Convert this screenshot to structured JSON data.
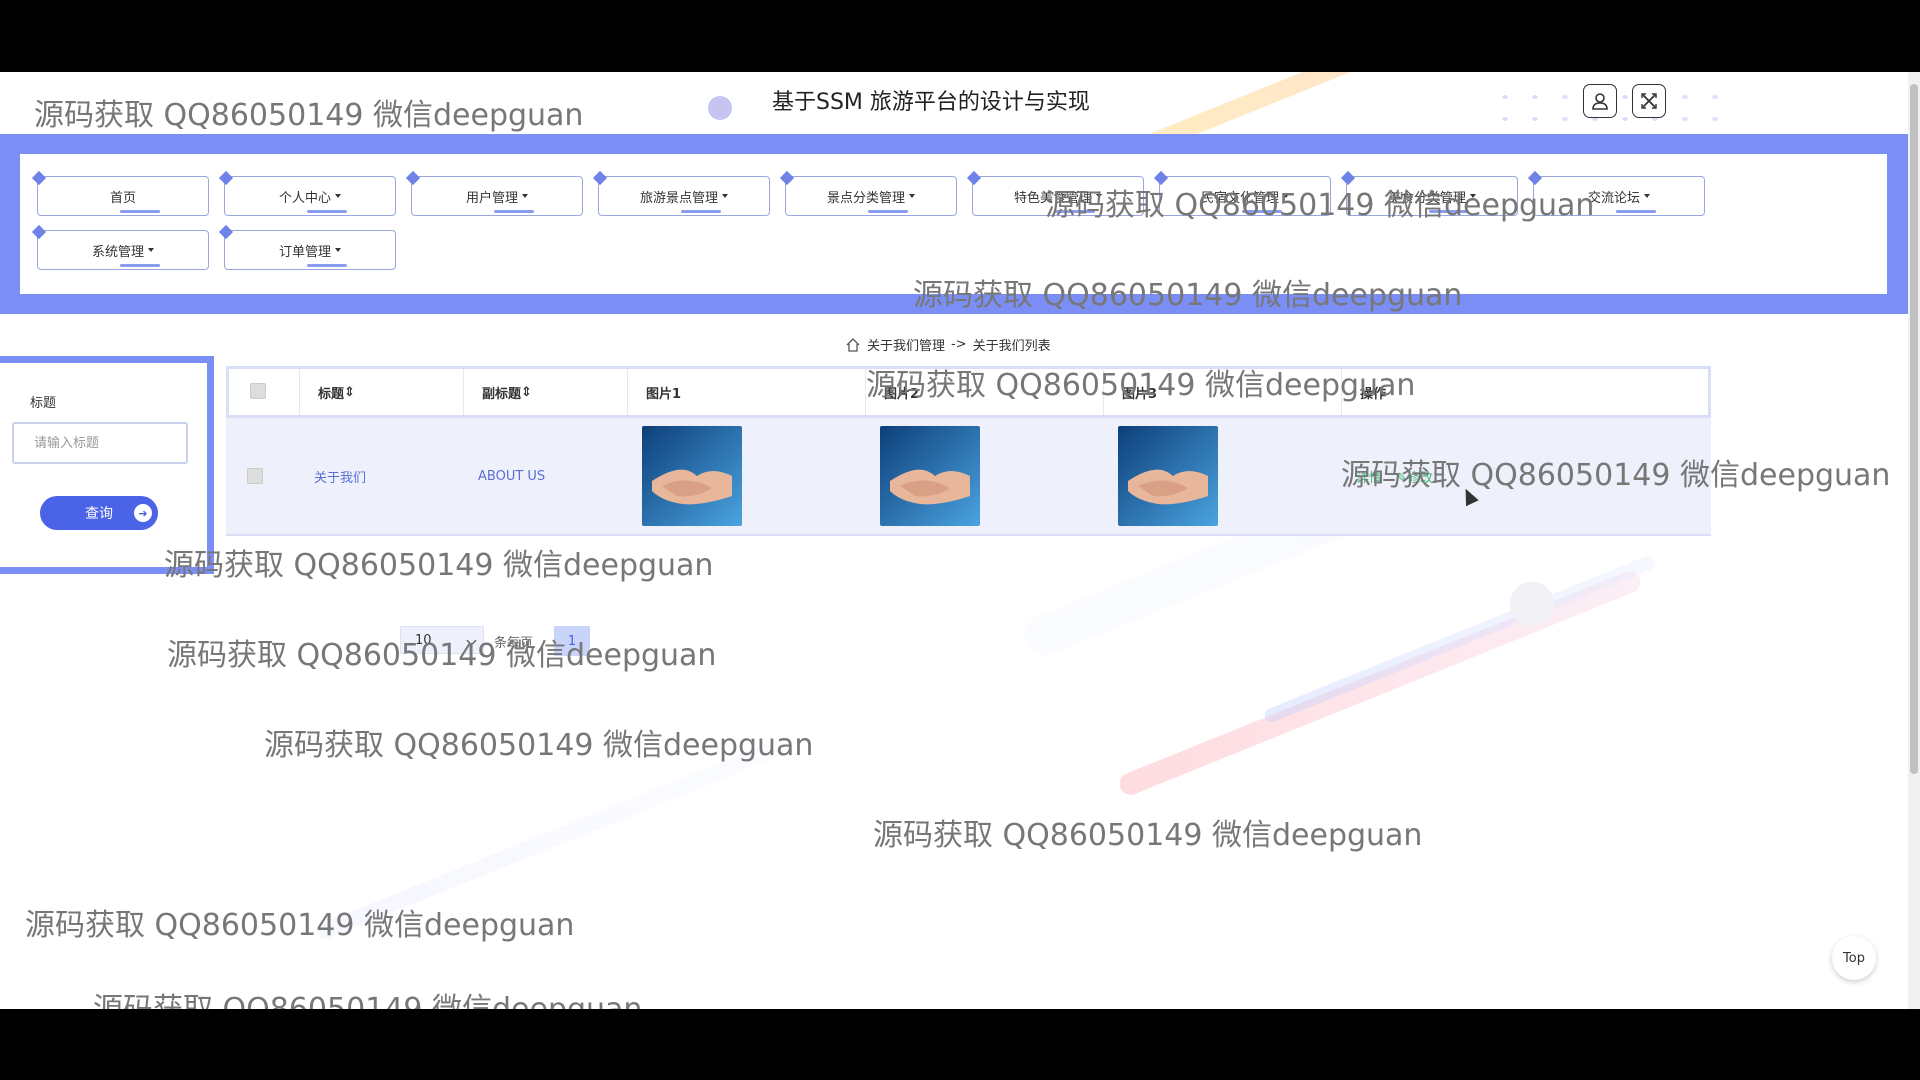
{
  "header": {
    "title": "基于SSM 旅游平台的设计与实现",
    "user_icon": "user-icon",
    "close_icon": "close-icon"
  },
  "nav": {
    "items": [
      {
        "label": "首页",
        "dropdown": false
      },
      {
        "label": "个人中心",
        "dropdown": true
      },
      {
        "label": "用户管理",
        "dropdown": true
      },
      {
        "label": "旅游景点管理",
        "dropdown": true
      },
      {
        "label": "景点分类管理",
        "dropdown": true
      },
      {
        "label": "特色美食管理",
        "dropdown": true
      },
      {
        "label": "民宿文化管理",
        "dropdown": true
      },
      {
        "label": "美食分类管理",
        "dropdown": true
      },
      {
        "label": "交流论坛",
        "dropdown": true
      },
      {
        "label": "系统管理",
        "dropdown": true
      },
      {
        "label": "订单管理",
        "dropdown": true
      }
    ]
  },
  "breadcrumb": {
    "home_icon": "home-icon",
    "parent": "关于我们管理",
    "separator": "->",
    "current": "关于我们列表"
  },
  "search": {
    "label": "标题",
    "placeholder": "请输入标题",
    "button": "查询"
  },
  "table": {
    "headers": [
      "标题",
      "副标题",
      "图片1",
      "图片2",
      "图片3",
      "操作"
    ],
    "rows": [
      {
        "title": "关于我们",
        "subtitle": "ABOUT US",
        "images": [
          "handshake-photo",
          "handshake-photo",
          "handshake-photo"
        ],
        "actions": [
          "详情",
          "修改"
        ]
      }
    ]
  },
  "pagination": {
    "page_size": "10",
    "per_page_label": "条每页",
    "current_page": "1"
  },
  "watermark": "源码获取 QQ86050149 微信deepguan",
  "top_button": "Top",
  "colors": {
    "accent": "#7b8ef6",
    "button": "#4b63e6",
    "link": "#5a6fd6",
    "action_detail": "#3cb371"
  }
}
